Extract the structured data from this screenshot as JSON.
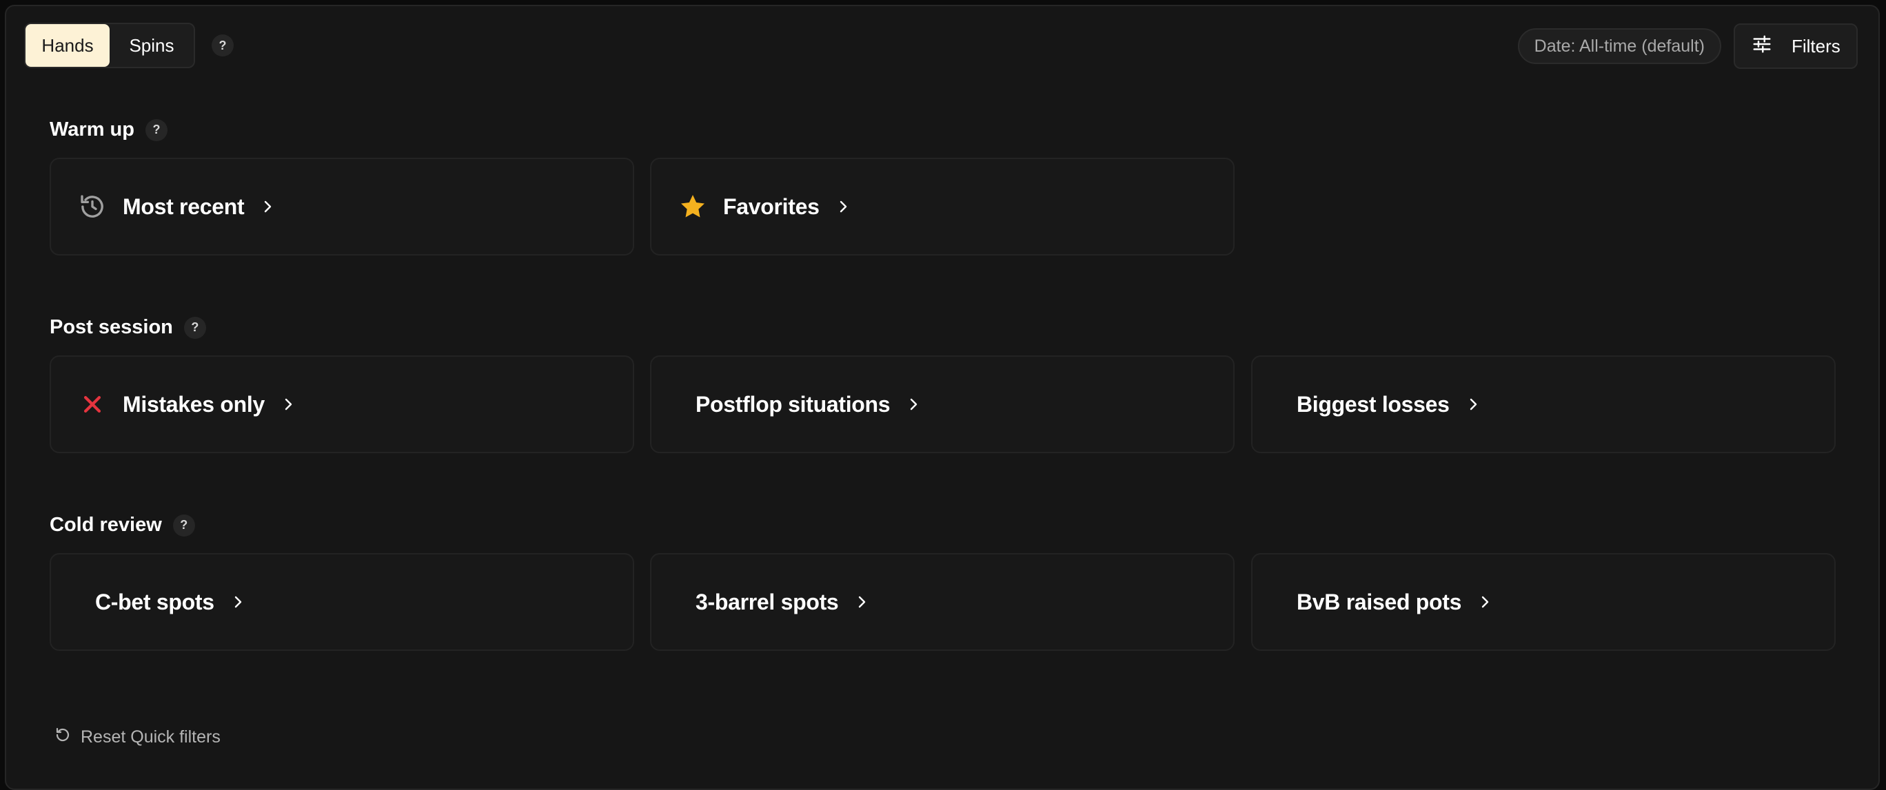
{
  "tabs": {
    "hands_label": "Hands",
    "spins_label": "Spins",
    "help": "?"
  },
  "toolbar": {
    "date_filter": "Date: All-time (default)",
    "filters_label": "Filters"
  },
  "sections": [
    {
      "title": "Warm up",
      "help": "?",
      "cards": [
        {
          "label": "Most recent",
          "icon": "history-icon"
        },
        {
          "label": "Favorites",
          "icon": "star-icon"
        }
      ]
    },
    {
      "title": "Post session",
      "help": "?",
      "cards": [
        {
          "label": "Mistakes only",
          "icon": "x-icon"
        },
        {
          "label": "Postflop situations",
          "icon": ""
        },
        {
          "label": "Biggest losses",
          "icon": ""
        }
      ]
    },
    {
      "title": "Cold review",
      "help": "?",
      "cards": [
        {
          "label": "C-bet spots",
          "icon": ""
        },
        {
          "label": "3-barrel spots",
          "icon": ""
        },
        {
          "label": "BvB raised pots",
          "icon": ""
        }
      ]
    }
  ],
  "reset_label": "Reset Quick filters",
  "colors": {
    "active_tab_bg": "#fdf2d6",
    "star": "#f4b11f",
    "mistake_x": "#e5343f",
    "background": "#161616"
  }
}
